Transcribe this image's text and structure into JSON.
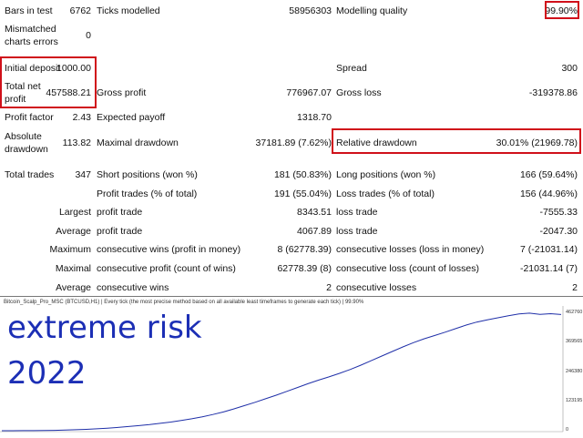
{
  "report": {
    "bars_in_test_label": "Bars in test",
    "bars_in_test_value": "6762",
    "ticks_modelled_label": "Ticks modelled",
    "ticks_modelled_value": "58956303",
    "modelling_quality_label": "Modelling quality",
    "modelling_quality_value": "99.90%",
    "mismatched_label_1": "Mismatched",
    "mismatched_label_2": "charts errors",
    "mismatched_value": "0",
    "initial_deposit_label": "Initial deposit",
    "initial_deposit_value": "1000.00",
    "spread_label": "Spread",
    "spread_value": "300",
    "net_profit_label_1": "Total net",
    "net_profit_label_2": "profit",
    "net_profit_value": "457588.21",
    "gross_profit_label": "Gross profit",
    "gross_profit_value": "776967.07",
    "gross_loss_label": "Gross loss",
    "gross_loss_value": "-319378.86",
    "profit_factor_label": "Profit factor",
    "profit_factor_value": "2.43",
    "expected_payoff_label": "Expected payoff",
    "expected_payoff_value": "1318.70",
    "abs_drawdown_label_1": "Absolute",
    "abs_drawdown_label_2": "drawdown",
    "abs_drawdown_value": "113.82",
    "max_drawdown_label": "Maximal drawdown",
    "max_drawdown_value": "37181.89 (7.62%)",
    "rel_drawdown_label": "Relative drawdown",
    "rel_drawdown_value": "30.01% (21969.78)",
    "total_trades_label": "Total trades",
    "total_trades_value": "347",
    "short_label": "Short positions (won %)",
    "short_value": "181 (50.83%)",
    "long_label": "Long positions (won %)",
    "long_value": "166 (59.64%)",
    "profit_trades_label": "Profit trades (% of total)",
    "profit_trades_value": "191 (55.04%)",
    "loss_trades_label": "Loss trades (% of total)",
    "loss_trades_value": "156 (44.96%)",
    "largest_label": "Largest",
    "largest_profit_label": "profit trade",
    "largest_profit_value": "8343.51",
    "largest_loss_label": "loss trade",
    "largest_loss_value": "-7555.33",
    "average_label": "Average",
    "average_profit_label": "profit trade",
    "average_profit_value": "4067.89",
    "average_loss_label": "loss trade",
    "average_loss_value": "-2047.30",
    "maximum_label": "Maximum",
    "max_cons_wins_label": "consecutive wins (profit in money)",
    "max_cons_wins_value": "8 (62778.39)",
    "max_cons_losses_label": "consecutive losses (loss in money)",
    "max_cons_losses_value": "7 (-21031.14)",
    "maximal_label": "Maximal",
    "maximal_cons_profit_label": "consecutive profit (count of wins)",
    "maximal_cons_profit_value": "62778.39 (8)",
    "maximal_cons_loss_label": "consecutive loss (count of losses)",
    "maximal_cons_loss_value": "-21031.14 (7)",
    "avg2_label": "Average",
    "avg_cons_wins_label": "consecutive wins",
    "avg_cons_wins_value": "2",
    "avg_cons_losses_label": "consecutive losses",
    "avg_cons_losses_value": "2"
  },
  "chart": {
    "header_text": "Bitcoin_Scalp_Pro_MSC (BTCUSD,H1) | Every tick (the most precise method based on all available least timeframes to generate each tick) | 99.90%",
    "overlay_line1": "extreme risk",
    "overlay_line2": "2022",
    "ytick_labels": [
      "462760",
      "369565",
      "246380",
      "123195",
      "0"
    ]
  },
  "colors": {
    "highlight": "#d0101a",
    "balance_line": "#1f2fa8",
    "overlay_text": "#1c2fb5"
  },
  "chart_data": {
    "type": "line",
    "series": [
      {
        "values": [
          0,
          0,
          200,
          500,
          900,
          1500,
          2500,
          4000,
          5500,
          7500,
          10000,
          13000,
          16500,
          20000,
          24000,
          29000,
          34000,
          40000,
          47000,
          55000,
          64000,
          74000,
          86000,
          99000,
          112000,
          126000,
          140000,
          155000,
          170000,
          185000,
          199000,
          212000,
          226000,
          241000,
          258000,
          276000,
          294000,
          312000,
          330000,
          347000,
          362000,
          375000,
          388000,
          402000,
          416000,
          428000,
          437000,
          445000,
          453000,
          460000,
          463000,
          458000,
          461000,
          457588
        ]
      }
    ],
    "ylim": [
      0,
      462760
    ]
  }
}
